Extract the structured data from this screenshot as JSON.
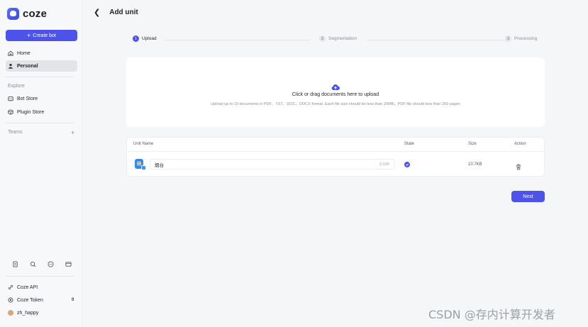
{
  "sidebar": {
    "brand": "coze",
    "create_button": "Create bot",
    "nav": [
      {
        "label": "Home"
      },
      {
        "label": "Personal"
      }
    ],
    "explore_label": "Explore",
    "explore_items": [
      {
        "label": "Bot Store"
      },
      {
        "label": "Plugin Store"
      }
    ],
    "teams_label": "Teams",
    "footer": [
      {
        "label": "Coze API"
      },
      {
        "label": "Coze Token",
        "count": "0"
      },
      {
        "label": "zh_happy"
      }
    ]
  },
  "header": {
    "title": "Add unit"
  },
  "steps": [
    {
      "num": "1",
      "label": "Upload",
      "active": true
    },
    {
      "num": "2",
      "label": "Segmentation",
      "active": false
    },
    {
      "num": "3",
      "label": "Processing",
      "active": false
    }
  ],
  "upload": {
    "title": "Click or drag documents here to upload",
    "subtitle": "Upload up to 10 documents in PDF、TXT、DOC、DOCX format. Each file size should be less than 20MB，PDF file should less than 250 pages"
  },
  "table": {
    "headers": {
      "name": "Unit Name",
      "state": "State",
      "size": "Size",
      "action": "Action"
    },
    "rows": [
      {
        "name": "烟台",
        "char_count": "2/100",
        "size": "10.7KB"
      }
    ]
  },
  "next_button": "Next",
  "watermark": "CSDN @存内计算开发者",
  "colors": {
    "accent": "#4d53e8",
    "doc_blue": "#2f8cf0"
  }
}
